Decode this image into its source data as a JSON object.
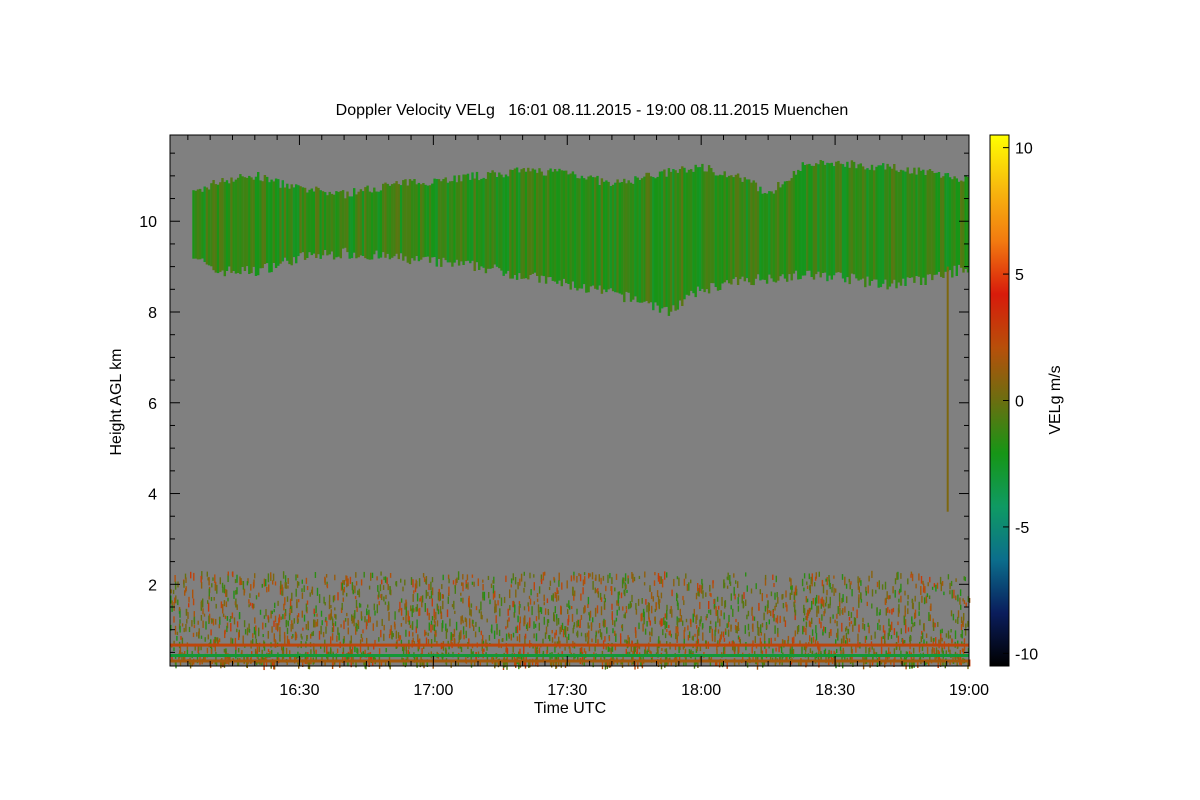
{
  "chart_data": {
    "type": "heatmap",
    "title": "Doppler Velocity VELg   16:01 08.11.2015 - 19:00 08.11.2015 Muenchen",
    "xlabel": "Time UTC",
    "ylabel": "Height AGL km",
    "colorbar_label": "VELg m/s",
    "x_range_minutes": [
      961,
      1140
    ],
    "x_ticks": [
      {
        "minute": 990,
        "label": "16:30"
      },
      {
        "minute": 1020,
        "label": "17:00"
      },
      {
        "minute": 1050,
        "label": "17:30"
      },
      {
        "minute": 1080,
        "label": "18:00"
      },
      {
        "minute": 1110,
        "label": "18:30"
      },
      {
        "minute": 1140,
        "label": "19:00"
      }
    ],
    "ylim": [
      0.2,
      11.9
    ],
    "y_ticks": [
      2,
      4,
      6,
      8,
      10
    ],
    "clim": [
      -10.5,
      10.5
    ],
    "colorbar_ticks": [
      -10,
      -5,
      0,
      5,
      10
    ],
    "background_color": "#808080",
    "colormap": [
      "#000000",
      "#0a1d5c",
      "#0b6e8c",
      "#0f9a63",
      "#169616",
      "#6b6e10",
      "#b84f0a",
      "#d81b0b",
      "#f27a10",
      "#f7b90e",
      "#ffff00"
    ],
    "cloud_layer": {
      "description_velocity_m_s": -1.5,
      "base_km": [
        [
          966,
          9.3
        ],
        [
          970,
          8.9
        ],
        [
          980,
          8.9
        ],
        [
          990,
          9.2
        ],
        [
          1000,
          9.3
        ],
        [
          1010,
          9.2
        ],
        [
          1020,
          9.1
        ],
        [
          1030,
          9.0
        ],
        [
          1040,
          8.8
        ],
        [
          1050,
          8.6
        ],
        [
          1060,
          8.4
        ],
        [
          1068,
          8.2
        ],
        [
          1072,
          8.0
        ],
        [
          1080,
          8.5
        ],
        [
          1090,
          8.7
        ],
        [
          1100,
          8.8
        ],
        [
          1110,
          8.8
        ],
        [
          1120,
          8.6
        ],
        [
          1130,
          8.7
        ],
        [
          1140,
          9.0
        ]
      ],
      "top_km": [
        [
          966,
          10.6
        ],
        [
          972,
          10.9
        ],
        [
          980,
          11.0
        ],
        [
          990,
          10.7
        ],
        [
          1000,
          10.6
        ],
        [
          1010,
          10.8
        ],
        [
          1020,
          10.9
        ],
        [
          1030,
          11.0
        ],
        [
          1040,
          11.1
        ],
        [
          1050,
          11.1
        ],
        [
          1060,
          10.8
        ],
        [
          1068,
          11.0
        ],
        [
          1080,
          11.2
        ],
        [
          1090,
          10.9
        ],
        [
          1095,
          10.6
        ],
        [
          1102,
          11.2
        ],
        [
          1110,
          11.3
        ],
        [
          1120,
          11.2
        ],
        [
          1130,
          11.1
        ],
        [
          1140,
          10.9
        ]
      ]
    },
    "boundary_layer": {
      "height_range_km": [
        0.3,
        2.3
      ],
      "velocity_range_m_s": [
        -2,
        3
      ]
    },
    "near_ground_bands": [
      {
        "height_km": 0.65,
        "velocity_m_s": 2.5
      },
      {
        "height_km": 0.42,
        "velocity_m_s": -3.0
      },
      {
        "height_km": 0.3,
        "velocity_m_s": 1.5
      }
    ],
    "precip_streak": {
      "minute": 1135,
      "height_range_km": [
        3.6,
        9.0
      ]
    }
  }
}
